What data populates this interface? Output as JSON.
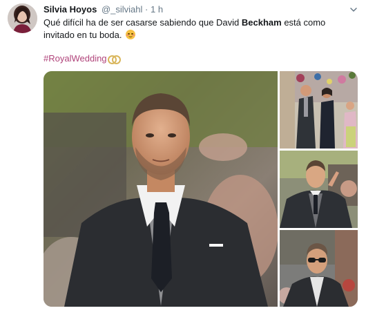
{
  "tweet": {
    "author_name": "Silvia Hoyos",
    "handle": "@_silviahl",
    "separator": "·",
    "time": "1 h",
    "text_before": "Qué difícil ha de ser casarse sabiendo que David ",
    "text_bold": "Beckham",
    "text_after": " está como invitado en tu boda.",
    "hashtag": "#RoyalWedding",
    "emoji_icon": "smiling-blushing-face-icon",
    "hashtag_icon": "wedding-rings-icon"
  },
  "colors": {
    "hashtag": "#b0437a",
    "secondary_text": "#657786",
    "primary_text": "#14171a"
  },
  "media": {
    "photos": [
      {
        "subject": "man-in-grey-suit-portrait"
      },
      {
        "subject": "couple-walking-crowd"
      },
      {
        "subject": "man-in-suit-gesturing"
      },
      {
        "subject": "man-in-sunglasses"
      }
    ]
  }
}
